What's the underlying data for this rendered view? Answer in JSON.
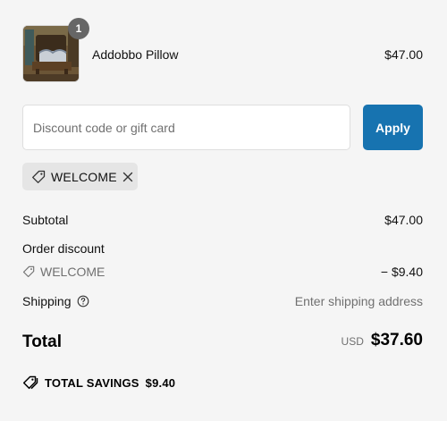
{
  "product": {
    "name": "Addobbo Pillow",
    "price": "$47.00",
    "quantity": "1"
  },
  "discount": {
    "placeholder": "Discount code or gift card",
    "value": "",
    "apply_label": "Apply",
    "applied_code": "WELCOME"
  },
  "summary": {
    "subtotal_label": "Subtotal",
    "subtotal_value": "$47.00",
    "order_discount_label": "Order discount",
    "order_discount_code": "WELCOME",
    "order_discount_value": "− $9.40",
    "shipping_label": "Shipping",
    "shipping_value": "Enter shipping address",
    "total_label": "Total",
    "total_currency": "USD",
    "total_value": "$37.60",
    "savings_label": "TOTAL SAVINGS",
    "savings_value": "$9.40"
  },
  "icons": {
    "tag": "tag-icon",
    "close": "close-icon",
    "help": "help-circle-icon",
    "savings": "savings-tag-icon"
  },
  "colors": {
    "background": "#f5f5f5",
    "accent": "#1773b0",
    "badge": "#666666",
    "chip": "#e5e5e5",
    "muted_text": "#707070"
  }
}
